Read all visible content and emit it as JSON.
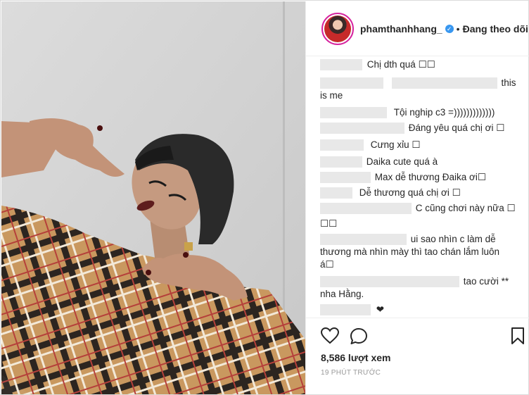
{
  "post": {
    "username": "phamthanhhang_",
    "follow_status": "Đang theo dõi",
    "separator": "•"
  },
  "comments": [
    {
      "text": "Chị dth quá ☐☐"
    },
    {
      "text": "this"
    },
    {
      "text": "is me"
    },
    {
      "text": "Tội nghip c3 =)))))))))))))"
    },
    {
      "text": "Đáng yêu quá chị ơi ☐"
    },
    {
      "text": "Cưng xỉu ☐"
    },
    {
      "text": "Daika cute quá à"
    },
    {
      "text": "Max dễ thương Đaika ơi☐"
    },
    {
      "text": "Dễ thương quá chị ơi ☐"
    },
    {
      "text": "C cũng chơi này nữa ☐"
    },
    {
      "text": "☐☐"
    },
    {
      "text": "ui sao nhìn c làm dễ"
    },
    {
      "text": "thương mà nhìn mày thì tao chán lắm luôn"
    },
    {
      "text": "á☐"
    },
    {
      "text": "tao cười **"
    },
    {
      "text": "nha Hằng."
    },
    {
      "text": "❤"
    }
  ],
  "footer": {
    "views": "8,586 lượt xem",
    "time": "19 PHÚT TRƯỚC"
  },
  "icons": [
    "heart-icon",
    "comment-icon",
    "bookmark-icon",
    "verified-icon"
  ],
  "colors": {
    "verified": "#3897f0",
    "avatar_ring": "#d6249f",
    "muted": "#999999",
    "text": "#262626"
  }
}
